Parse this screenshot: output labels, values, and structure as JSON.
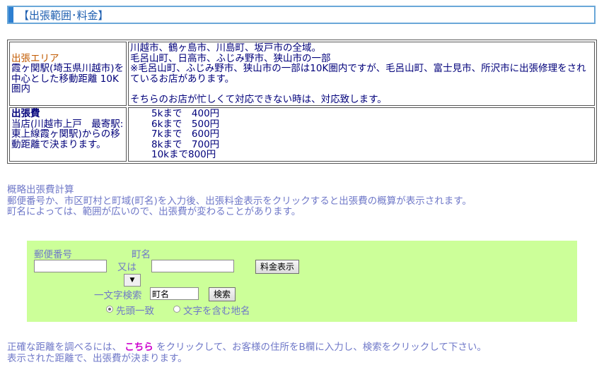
{
  "header": {
    "title": "【出張範囲･料金】"
  },
  "table": {
    "area": {
      "label": "出張エリア",
      "desc": "霞ヶ関駅(埼玉県川越市)を中心とした移動距離 10K 圏内",
      "lines": [
        "川越市、鶴ヶ島市、川島町、坂戸市の全域。",
        "毛呂山町、日高市、ふじみ野市、狭山市の一部",
        "※毛呂山町、ふじみ野市、狭山市の一部は10K圏内ですが、毛呂山町、富士見市、所沢市に出張修理をされているお店があります。",
        "そちらのお店が忙しくて対応できない時は、対応致します。"
      ]
    },
    "fee": {
      "label": "出張費",
      "desc": "当店(川越市上戸　最寄駅:東上線霞ヶ関駅)からの移動距離で決まります。",
      "rows": [
        "5kまで　400円",
        "6kまで　500円",
        "7kまで　600円",
        "8kまで　700円",
        "10kまで800円"
      ]
    }
  },
  "calc": {
    "title": "概略出張費計算",
    "line1": "郵便番号か、市区町村と町域(町名)を入力後、出張料金表示をクリックすると出張費の概算が表示されます。",
    "line2": "町名によっては、範囲が広いので、出張費が変わることがあります。"
  },
  "form": {
    "postal_label": "郵便番号",
    "or_label": "又は",
    "town_label": "町名",
    "show_fee_button": "料金表示",
    "select_arrow": "▼",
    "search_label": "一文字検索",
    "search_value": "町名",
    "search_button": "検索",
    "radio_prefix": "先頭一致",
    "radio_contains": "文字を含む地名"
  },
  "note": {
    "before_link": "正確な距離を調べるには、",
    "link": "こちら",
    "after_link": "をクリックして、お客様の住所をB欄に入力し、検索をクリックして下さい。",
    "line2": "表示された距離で、出張費が決まります。"
  }
}
